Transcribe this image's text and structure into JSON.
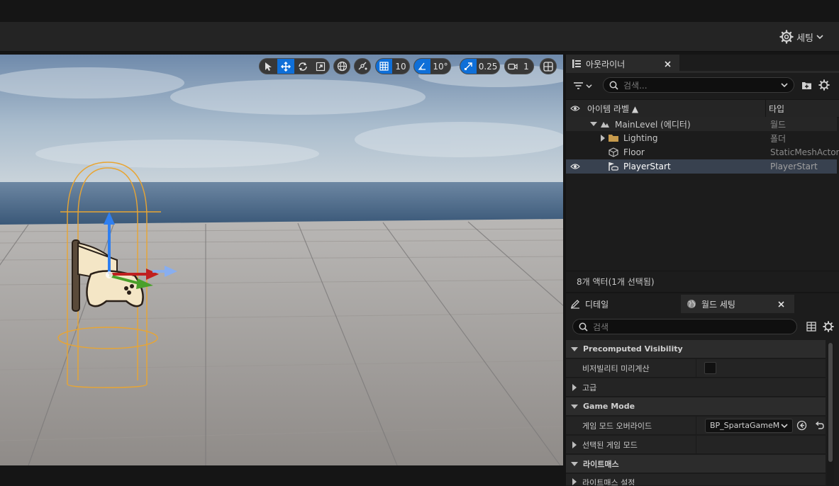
{
  "toolbar": {
    "settings_label": "세팅"
  },
  "viewport": {
    "toolbar": {
      "grid_snap_value": "10",
      "rotation_snap_value": "10°",
      "scale_snap_value": "0.25",
      "camera_speed_value": "1"
    }
  },
  "outliner": {
    "tab_title": "아웃라이너",
    "search_placeholder": "검색...",
    "col_label": "아이템 라벨 ▲",
    "col_type": "타입",
    "rows": [
      {
        "label": "MainLevel (에디터)",
        "type": "월드"
      },
      {
        "label": "Lighting",
        "type": "폴더"
      },
      {
        "label": "Floor",
        "type": "StaticMeshActor"
      },
      {
        "label": "PlayerStart",
        "type": "PlayerStart"
      }
    ],
    "footer": "8개 액터(1개 선택됨)"
  },
  "details": {
    "tab_details": "디테일",
    "tab_world_settings": "월드 세팅",
    "search_placeholder": "검색",
    "sections": {
      "precomputed": "Precomputed Visibility",
      "game_mode": "Game Mode",
      "lightmass": "라이트매스"
    },
    "props": {
      "precompute_visibility": "비저빌리티 미리계산",
      "advanced": "고급",
      "game_mode_override": "게임 모드 오버라이드",
      "game_mode_override_value": "BP_SpartaGameM",
      "selected_game_mode": "선택된 게임 모드",
      "lightmass_settings": "라이트매스 설정"
    }
  },
  "colors": {
    "accent": "#0f6fd8",
    "selection": "#38414f",
    "gizmo_orange": "#e8a533"
  }
}
